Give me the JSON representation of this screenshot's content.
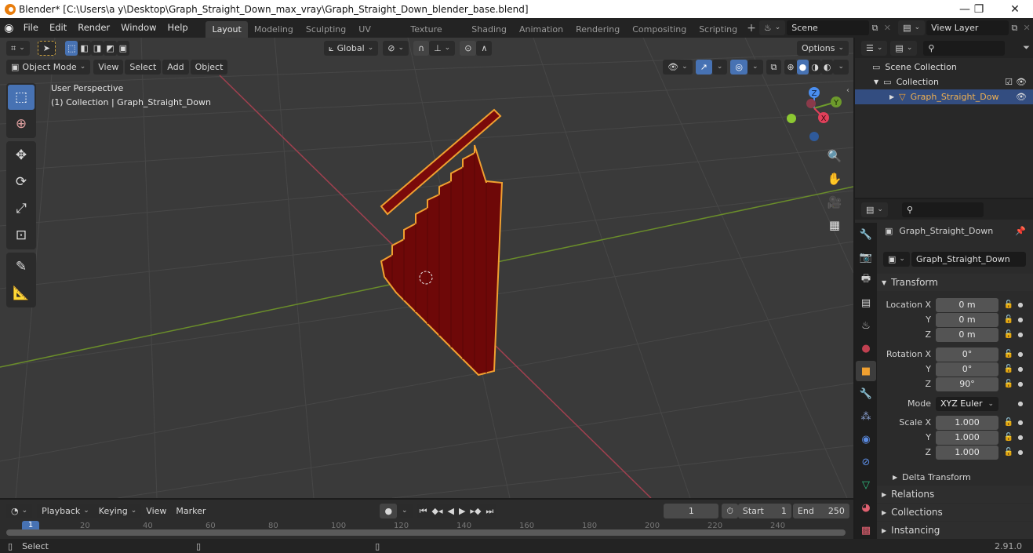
{
  "window": {
    "title": "Blender* [C:\\Users\\a y\\Desktop\\Graph_Straight_Down_max_vray\\Graph_Straight_Down_blender_base.blend]",
    "minimize": "—",
    "maximize": "❐",
    "close": "✕"
  },
  "menu": [
    "File",
    "Edit",
    "Render",
    "Window",
    "Help"
  ],
  "workspaces": [
    {
      "label": "Layout",
      "active": true
    },
    {
      "label": "Modeling"
    },
    {
      "label": "Sculpting"
    },
    {
      "label": "UV Editing"
    },
    {
      "label": "Texture Paint"
    },
    {
      "label": "Shading"
    },
    {
      "label": "Animation"
    },
    {
      "label": "Rendering"
    },
    {
      "label": "Compositing"
    },
    {
      "label": "Scripting"
    }
  ],
  "add_workspace": "+",
  "scene": {
    "name": "Scene"
  },
  "view_layer": {
    "name": "View Layer"
  },
  "viewport": {
    "orientation": "Global",
    "options_label": "Options",
    "mode": "Object Mode",
    "menus": [
      "View",
      "Select",
      "Add",
      "Object"
    ],
    "overlay_title": "User Perspective",
    "overlay_subtitle": "(1) Collection | Graph_Straight_Down",
    "gizmo_axes": {
      "x": "X",
      "y": "Y",
      "z": "Z"
    },
    "colors": {
      "x_axis": "#b5485a",
      "y_axis": "#6d9a2c",
      "object": "#7a0a0a",
      "selection": "#f0a030",
      "active_blue": "#4772b3"
    }
  },
  "outliner": {
    "scene_collection": "Scene Collection",
    "collection": "Collection",
    "object": "Graph_Straight_Dow"
  },
  "properties": {
    "object_name": "Graph_Straight_Down",
    "data_name": "Graph_Straight_Down",
    "transform_label": "Transform",
    "location": {
      "label": "Location X",
      "x": "0 m",
      "y": "0 m",
      "z": "0 m"
    },
    "rotation": {
      "label": "Rotation X",
      "x": "0°",
      "y": "0°",
      "z": "90°"
    },
    "mode_label": "Mode",
    "mode_value": "XYZ Euler",
    "scale": {
      "label": "Scale X",
      "x": "1.000",
      "y": "1.000",
      "z": "1.000"
    },
    "axis_y": "Y",
    "axis_z": "Z",
    "sections": [
      "Delta Transform",
      "Relations",
      "Collections",
      "Instancing"
    ]
  },
  "timeline": {
    "menus": [
      "Playback",
      "Keying",
      "View",
      "Marker"
    ],
    "current_frame": "1",
    "start_label": "Start",
    "start": "1",
    "end_label": "End",
    "end": "250",
    "ticks": [
      "1",
      "20",
      "40",
      "60",
      "80",
      "100",
      "120",
      "140",
      "160",
      "180",
      "200",
      "220",
      "240"
    ]
  },
  "status": {
    "select": "Select",
    "version": "2.91.0"
  }
}
